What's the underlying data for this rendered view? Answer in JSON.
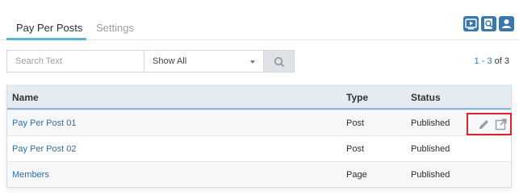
{
  "tabs": [
    {
      "label": "Pay Per Posts",
      "active": true
    },
    {
      "label": "Settings",
      "active": false
    }
  ],
  "toolbar_icons": [
    "video-icon",
    "search-doc-icon",
    "user-card-icon"
  ],
  "filters": {
    "search_placeholder": "Search Text",
    "select_value": "Show All"
  },
  "pager": {
    "range": "1 - 3",
    "of": "of",
    "total": "3"
  },
  "table": {
    "columns": [
      "Name",
      "Type",
      "Status"
    ],
    "rows": [
      {
        "name": "Pay Per Post 01",
        "type": "Post",
        "status": "Published"
      },
      {
        "name": "Pay Per Post 02",
        "type": "Post",
        "status": "Published"
      },
      {
        "name": "Members",
        "type": "Page",
        "status": "Published"
      }
    ]
  },
  "colors": {
    "accent": "#3b77a8",
    "tab_underline": "#5ab4d6",
    "highlight_border": "#e0202a"
  }
}
